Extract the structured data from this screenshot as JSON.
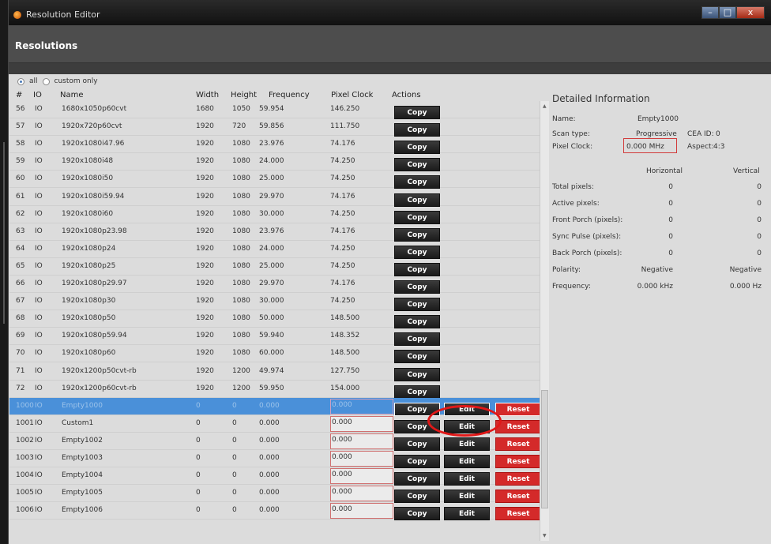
{
  "window": {
    "title": "Resolution Editor",
    "minimize": "–",
    "maximize": "□",
    "close": "x"
  },
  "header": {
    "title": "Resolutions"
  },
  "filter": {
    "all_label": "all",
    "custom_label": "custom only",
    "selected": "all"
  },
  "columns": [
    "#",
    "IO",
    "Name",
    "Width",
    "Height",
    "Frequency",
    "Pixel Clock",
    "Actions"
  ],
  "buttons": {
    "copy": "Copy",
    "edit": "Edit",
    "reset": "Reset"
  },
  "rows": [
    {
      "num": "56",
      "io": "IO",
      "name": "1680x1050p60cvt",
      "width": "1680",
      "height": "1050",
      "freq": "59.954",
      "pclk": "146.250",
      "custom": false
    },
    {
      "num": "57",
      "io": "IO",
      "name": "1920x720p60cvt",
      "width": "1920",
      "height": "720",
      "freq": "59.856",
      "pclk": "111.750",
      "custom": false
    },
    {
      "num": "58",
      "io": "IO",
      "name": "1920x1080i47.96",
      "width": "1920",
      "height": "1080",
      "freq": "23.976",
      "pclk": "74.176",
      "custom": false
    },
    {
      "num": "59",
      "io": "IO",
      "name": "1920x1080i48",
      "width": "1920",
      "height": "1080",
      "freq": "24.000",
      "pclk": "74.250",
      "custom": false
    },
    {
      "num": "60",
      "io": "IO",
      "name": "1920x1080i50",
      "width": "1920",
      "height": "1080",
      "freq": "25.000",
      "pclk": "74.250",
      "custom": false
    },
    {
      "num": "61",
      "io": "IO",
      "name": "1920x1080i59.94",
      "width": "1920",
      "height": "1080",
      "freq": "29.970",
      "pclk": "74.176",
      "custom": false
    },
    {
      "num": "62",
      "io": "IO",
      "name": "1920x1080i60",
      "width": "1920",
      "height": "1080",
      "freq": "30.000",
      "pclk": "74.250",
      "custom": false
    },
    {
      "num": "63",
      "io": "IO",
      "name": "1920x1080p23.98",
      "width": "1920",
      "height": "1080",
      "freq": "23.976",
      "pclk": "74.176",
      "custom": false
    },
    {
      "num": "64",
      "io": "IO",
      "name": "1920x1080p24",
      "width": "1920",
      "height": "1080",
      "freq": "24.000",
      "pclk": "74.250",
      "custom": false
    },
    {
      "num": "65",
      "io": "IO",
      "name": "1920x1080p25",
      "width": "1920",
      "height": "1080",
      "freq": "25.000",
      "pclk": "74.250",
      "custom": false
    },
    {
      "num": "66",
      "io": "IO",
      "name": "1920x1080p29.97",
      "width": "1920",
      "height": "1080",
      "freq": "29.970",
      "pclk": "74.176",
      "custom": false
    },
    {
      "num": "67",
      "io": "IO",
      "name": "1920x1080p30",
      "width": "1920",
      "height": "1080",
      "freq": "30.000",
      "pclk": "74.250",
      "custom": false
    },
    {
      "num": "68",
      "io": "IO",
      "name": "1920x1080p50",
      "width": "1920",
      "height": "1080",
      "freq": "50.000",
      "pclk": "148.500",
      "custom": false
    },
    {
      "num": "69",
      "io": "IO",
      "name": "1920x1080p59.94",
      "width": "1920",
      "height": "1080",
      "freq": "59.940",
      "pclk": "148.352",
      "custom": false
    },
    {
      "num": "70",
      "io": "IO",
      "name": "1920x1080p60",
      "width": "1920",
      "height": "1080",
      "freq": "60.000",
      "pclk": "148.500",
      "custom": false
    },
    {
      "num": "71",
      "io": "IO",
      "name": "1920x1200p50cvt-rb",
      "width": "1920",
      "height": "1200",
      "freq": "49.974",
      "pclk": "127.750",
      "custom": false
    },
    {
      "num": "72",
      "io": "IO",
      "name": "1920x1200p60cvt-rb",
      "width": "1920",
      "height": "1200",
      "freq": "59.950",
      "pclk": "154.000",
      "custom": false
    },
    {
      "num": "1000",
      "io": "IO",
      "name": "Empty1000",
      "width": "0",
      "height": "0",
      "freq": "0.000",
      "pclk": "0.000",
      "custom": true,
      "selected": true
    },
    {
      "num": "1001",
      "io": "IO",
      "name": "Custom1",
      "width": "0",
      "height": "0",
      "freq": "0.000",
      "pclk": "0.000",
      "custom": true
    },
    {
      "num": "1002",
      "io": "IO",
      "name": "Empty1002",
      "width": "0",
      "height": "0",
      "freq": "0.000",
      "pclk": "0.000",
      "custom": true
    },
    {
      "num": "1003",
      "io": "IO",
      "name": "Empty1003",
      "width": "0",
      "height": "0",
      "freq": "0.000",
      "pclk": "0.000",
      "custom": true
    },
    {
      "num": "1004",
      "io": "IO",
      "name": "Empty1004",
      "width": "0",
      "height": "0",
      "freq": "0.000",
      "pclk": "0.000",
      "custom": true
    },
    {
      "num": "1005",
      "io": "IO",
      "name": "Empty1005",
      "width": "0",
      "height": "0",
      "freq": "0.000",
      "pclk": "0.000",
      "custom": true
    },
    {
      "num": "1006",
      "io": "IO",
      "name": "Empty1006",
      "width": "0",
      "height": "0",
      "freq": "0.000",
      "pclk": "0.000",
      "custom": true
    }
  ],
  "detail": {
    "title": "Detailed Information",
    "name_label": "Name:",
    "name_value": "Empty1000",
    "scan_label": "Scan type:",
    "scan_value": "Progressive",
    "cea_label": "CEA ID:",
    "cea_value": "0",
    "pclk_label": "Pixel Clock:",
    "pclk_value": "0.000 MHz",
    "aspect_label": "Aspect:",
    "aspect_value": "4:3",
    "horizontal_header": "Horizontal",
    "vertical_header": "Vertical",
    "timing": [
      {
        "label": "Total pixels:",
        "h": "0",
        "v": "0"
      },
      {
        "label": "Active pixels:",
        "h": "0",
        "v": "0"
      },
      {
        "label": "Front Porch (pixels):",
        "h": "0",
        "v": "0"
      },
      {
        "label": "Sync Pulse (pixels):",
        "h": "0",
        "v": "0"
      },
      {
        "label": "Back Porch (pixels):",
        "h": "0",
        "v": "0"
      },
      {
        "label": "Polarity:",
        "h": "Negative",
        "v": "Negative"
      },
      {
        "label": "Frequency:",
        "h": "0.000 kHz",
        "v": "0.000 Hz"
      }
    ]
  },
  "colors": {
    "selection": "#4a90d9",
    "reset": "#d42a2a",
    "annotation": "#e01818",
    "header": "#4d4d4d"
  }
}
